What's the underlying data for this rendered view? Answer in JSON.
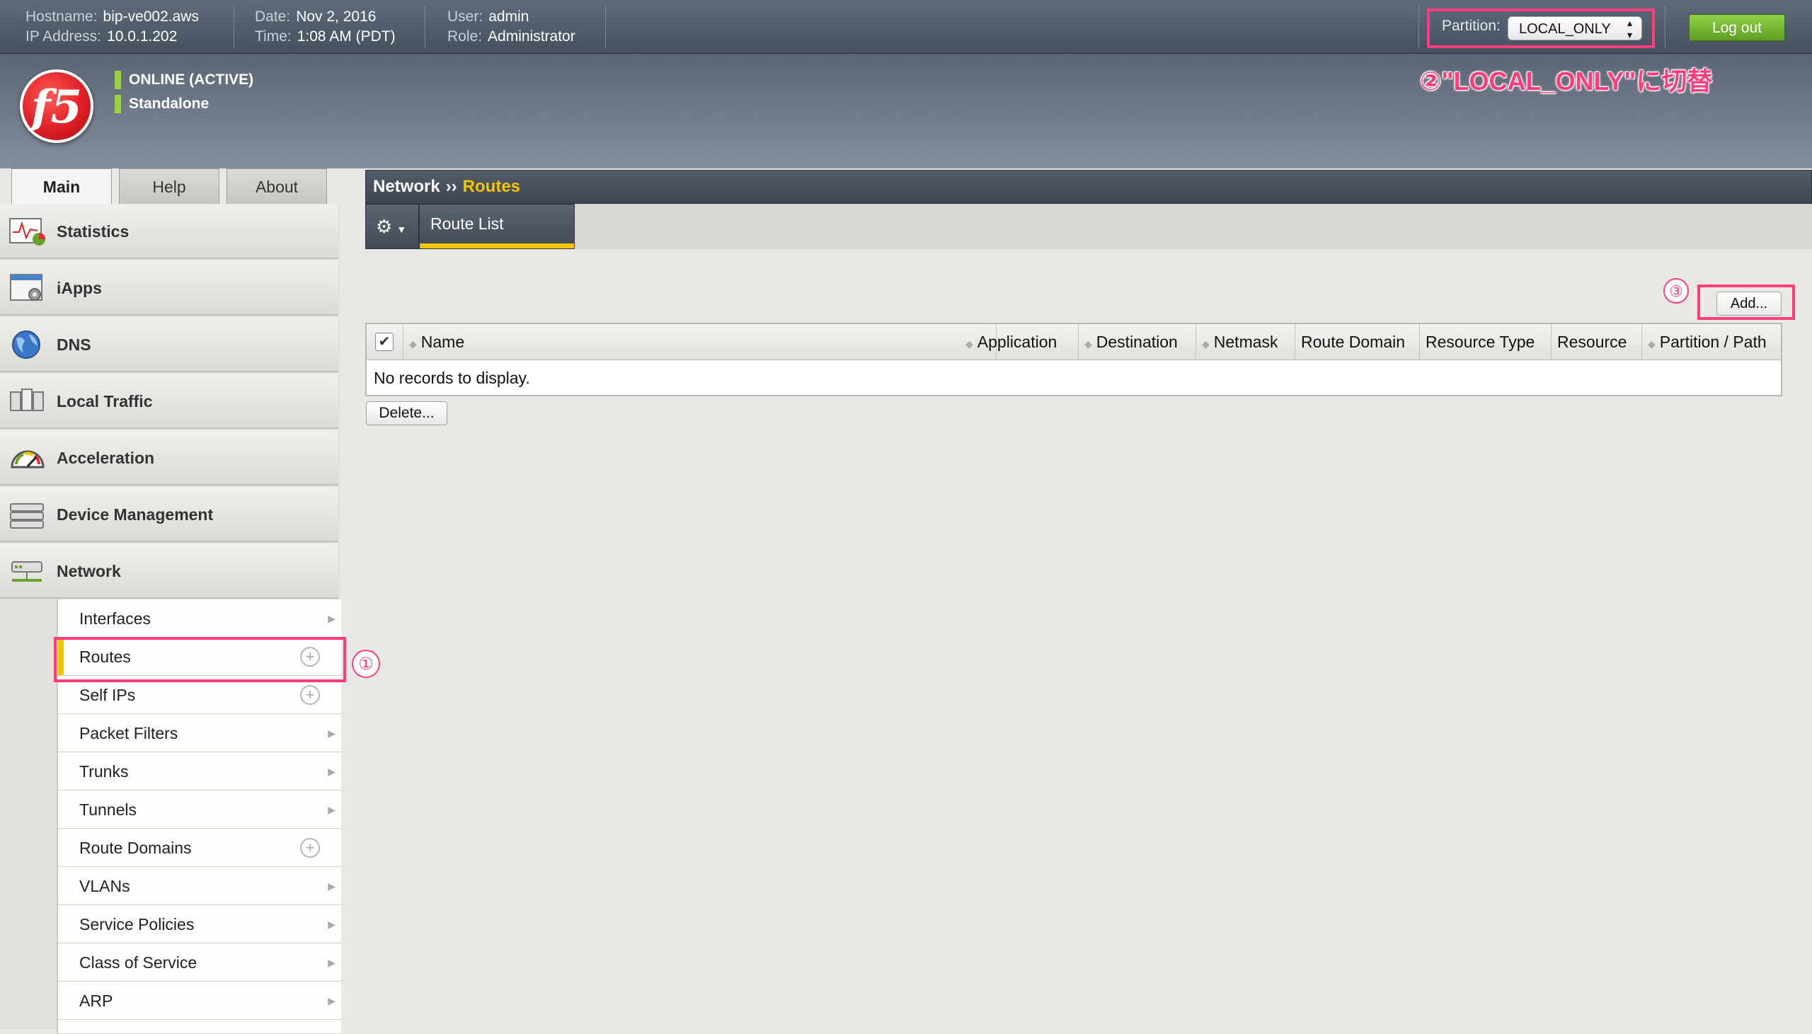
{
  "header": {
    "hostname_label": "Hostname:",
    "hostname": "bip-ve002.aws",
    "ip_label": "IP Address:",
    "ip": "10.0.1.202",
    "date_label": "Date:",
    "date": "Nov 2, 2016",
    "time_label": "Time:",
    "time": "1:08 AM (PDT)",
    "user_label": "User:",
    "user": "admin",
    "role_label": "Role:",
    "role": "Administrator",
    "partition_label": "Partition:",
    "partition_value": "LOCAL_ONLY",
    "logout_label": "Log out"
  },
  "banner": {
    "logo_text": "f5",
    "status_online": "ONLINE (ACTIVE)",
    "status_mode": "Standalone",
    "annotation_2": "②\"LOCAL_ONLY\"に切替"
  },
  "tabs": [
    {
      "label": "Main"
    },
    {
      "label": "Help"
    },
    {
      "label": "About"
    }
  ],
  "sidebar": {
    "categories": [
      {
        "label": "Statistics",
        "icon": "statistics-icon"
      },
      {
        "label": "iApps",
        "icon": "iapps-icon"
      },
      {
        "label": "DNS",
        "icon": "dns-icon"
      },
      {
        "label": "Local Traffic",
        "icon": "local-traffic-icon"
      },
      {
        "label": "Acceleration",
        "icon": "acceleration-icon"
      },
      {
        "label": "Device Management",
        "icon": "device-management-icon"
      },
      {
        "label": "Network",
        "icon": "network-icon"
      }
    ],
    "network_items": [
      {
        "label": "Interfaces"
      },
      {
        "label": "Routes"
      },
      {
        "label": "Self IPs"
      },
      {
        "label": "Packet Filters"
      },
      {
        "label": "Trunks"
      },
      {
        "label": "Tunnels"
      },
      {
        "label": "Route Domains"
      },
      {
        "label": "VLANs"
      },
      {
        "label": "Service Policies"
      },
      {
        "label": "Class of Service"
      },
      {
        "label": "ARP"
      }
    ],
    "annotation_1": "①"
  },
  "content": {
    "breadcrumb_parent": "Network",
    "breadcrumb_sep": "››",
    "breadcrumb_current": "Routes",
    "subtab_label": "Route List",
    "add_label": "Add...",
    "annotation_3": "③",
    "columns": [
      "Name",
      "Application",
      "Destination",
      "Netmask",
      "Route Domain",
      "Resource Type",
      "Resource",
      "Partition / Path"
    ],
    "empty_message": "No records to display.",
    "delete_label": "Delete..."
  },
  "colors": {
    "accent_yellow": "#f2c500",
    "annotation_pink": "#ff3d7a",
    "logout_green": "#6fb02a"
  }
}
